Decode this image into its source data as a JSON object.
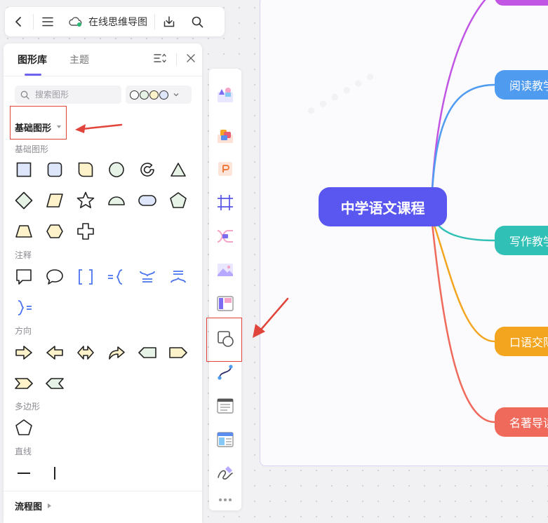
{
  "topbar": {
    "title": "在线思维导图",
    "icons": [
      "back-icon",
      "menu-icon",
      "cloud-saved-icon",
      "download-icon",
      "search-icon"
    ]
  },
  "panel": {
    "tabs": [
      {
        "label": "图形库",
        "active": true
      },
      {
        "label": "主题",
        "active": false
      }
    ],
    "search_placeholder": "搜索图形",
    "color_swatches": [
      "#ffffff",
      "#e6f3e6",
      "#fdf2c9",
      "#dde6fb"
    ],
    "category": "基础图形",
    "sections": [
      {
        "label": "基础图形",
        "shapes": [
          "rectangle-icon",
          "rounded-rect-icon",
          "round-corner-rect-icon",
          "circle-icon",
          "arc-ring-icon",
          "triangle-icon",
          "diamond-icon",
          "parallelogram-icon",
          "star-icon",
          "half-circle-icon",
          "capsule-icon",
          "pentagon-icon",
          "trapezoid-icon",
          "hexagon-icon",
          "cross-icon"
        ]
      },
      {
        "label": "注释",
        "shapes": [
          "speech-bubble-rect-icon",
          "speech-bubble-round-icon",
          "square-brackets-icon",
          "left-brace-icon",
          "top-brace-icon",
          "bottom-brace-icon",
          "right-brace-icon"
        ]
      },
      {
        "label": "方向",
        "shapes": [
          "arrow-right-icon",
          "arrow-left-icon",
          "arrow-both-icon",
          "arrow-curved-icon",
          "tag-left-icon",
          "tag-right-icon",
          "chevron-right-shape-icon",
          "chevron-left-shape-icon"
        ]
      },
      {
        "label": "多边形",
        "shapes": [
          "pentagon-outline-icon"
        ]
      },
      {
        "label": "直线",
        "shapes": [
          "horizontal-line-icon",
          "vertical-line-icon"
        ]
      }
    ],
    "flow_label": "流程图"
  },
  "toolbar": {
    "tools": [
      "template-icon",
      "style-icon",
      "ppt-icon",
      "frame-icon",
      "relation-icon",
      "image-icon",
      "layout-icon",
      "shape-icon",
      "connector-icon",
      "text-list-icon",
      "table-icon",
      "pen-icon",
      "more-icon"
    ]
  },
  "mindmap": {
    "central": "中学语文课程",
    "branches": [
      {
        "label": "阅读教学",
        "color": "#4f9bf0"
      },
      {
        "label": "写作教学",
        "color": "#31c0b6"
      },
      {
        "label": "口语交际",
        "color": "#f4a520"
      },
      {
        "label": "名著导读",
        "color": "#f06a5c"
      }
    ],
    "top_branch_color": "#c155e4"
  },
  "colors": {
    "accent": "#6e62f0",
    "central_node": "#5a57f0",
    "annotation_red": "#e0443a"
  }
}
